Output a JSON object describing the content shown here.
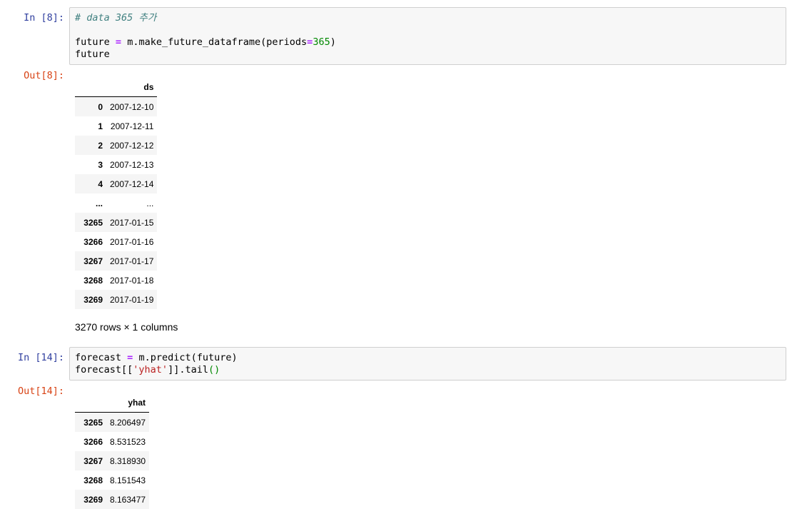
{
  "cells": [
    {
      "in_prompt": "In [8]:",
      "code": {
        "comment": "# data 365 추가",
        "line2": {
          "var": "future",
          "op": "=",
          "call": "m.make_future_dataframe(periods",
          "eq": "=",
          "num": "365",
          "close": ")"
        },
        "line3": "future"
      },
      "out_prompt": "Out[8]:",
      "table": {
        "columns": [
          "ds"
        ],
        "rows": [
          {
            "index": "0",
            "values": [
              "2007-12-10"
            ]
          },
          {
            "index": "1",
            "values": [
              "2007-12-11"
            ]
          },
          {
            "index": "2",
            "values": [
              "2007-12-12"
            ]
          },
          {
            "index": "3",
            "values": [
              "2007-12-13"
            ]
          },
          {
            "index": "4",
            "values": [
              "2007-12-14"
            ]
          },
          {
            "index": "...",
            "values": [
              "..."
            ]
          },
          {
            "index": "3265",
            "values": [
              "2017-01-15"
            ]
          },
          {
            "index": "3266",
            "values": [
              "2017-01-16"
            ]
          },
          {
            "index": "3267",
            "values": [
              "2017-01-17"
            ]
          },
          {
            "index": "3268",
            "values": [
              "2017-01-18"
            ]
          },
          {
            "index": "3269",
            "values": [
              "2017-01-19"
            ]
          }
        ]
      },
      "summary": "3270 rows × 1 columns"
    },
    {
      "in_prompt": "In [14]:",
      "code": {
        "line1": {
          "var": "forecast",
          "op": "=",
          "rest": "m.predict(future)"
        },
        "line2": {
          "pre": "forecast[[",
          "str": "'yhat'",
          "mid": "]].tail",
          "paren": "()"
        }
      },
      "out_prompt": "Out[14]:",
      "table": {
        "columns": [
          "yhat"
        ],
        "rows": [
          {
            "index": "3265",
            "values": [
              "8.206497"
            ]
          },
          {
            "index": "3266",
            "values": [
              "8.531523"
            ]
          },
          {
            "index": "3267",
            "values": [
              "8.318930"
            ]
          },
          {
            "index": "3268",
            "values": [
              "8.151543"
            ]
          },
          {
            "index": "3269",
            "values": [
              "8.163477"
            ]
          }
        ]
      }
    }
  ]
}
